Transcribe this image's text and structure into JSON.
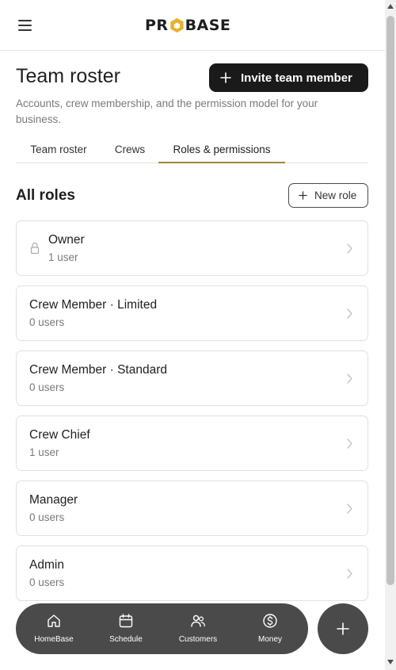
{
  "header": {
    "logo_text_left": "PR",
    "logo_text_right": "BASE",
    "logo_icon": "hexagon-o-logo",
    "menu_icon": "hamburger-icon"
  },
  "page": {
    "title": "Team roster",
    "subtitle": "Accounts, crew membership, and the permission model for your business.",
    "invite_label": "Invite team member"
  },
  "tabs": [
    {
      "label": "Team roster",
      "active": false
    },
    {
      "label": "Crews",
      "active": false
    },
    {
      "label": "Roles & permissions",
      "active": true
    }
  ],
  "roles_section": {
    "title": "All roles",
    "new_role_label": "New role",
    "roles": [
      {
        "name": "Owner",
        "count": "1 user",
        "locked": true
      },
      {
        "name": "Crew Member · Limited",
        "count": "0 users",
        "locked": false
      },
      {
        "name": "Crew Member · Standard",
        "count": "0 users",
        "locked": false
      },
      {
        "name": "Crew Chief",
        "count": "1 user",
        "locked": false
      },
      {
        "name": "Manager",
        "count": "0 users",
        "locked": false
      },
      {
        "name": "Admin",
        "count": "0 users",
        "locked": false
      }
    ]
  },
  "bottom_nav": [
    {
      "label": "HomeBase",
      "icon": "home-icon"
    },
    {
      "label": "Schedule",
      "icon": "calendar-icon"
    },
    {
      "label": "Customers",
      "icon": "users-icon"
    },
    {
      "label": "Money",
      "icon": "dollar-icon"
    }
  ],
  "colors": {
    "accent": "#a1873d",
    "logo_gold": "#e8b12b",
    "primary_button": "#1a1a1a",
    "nav_background": "#4a4a4a"
  }
}
